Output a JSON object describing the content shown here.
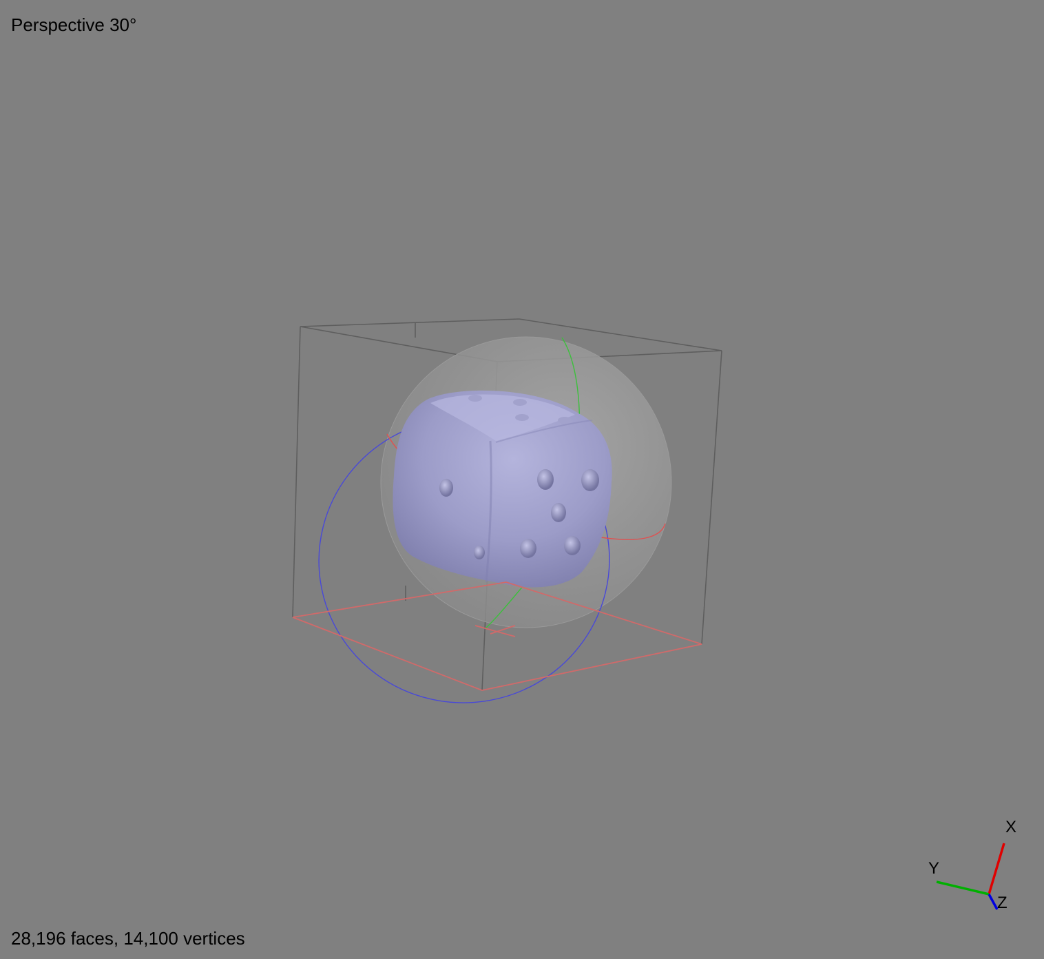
{
  "viewport": {
    "background": "#808080",
    "camera_mode": "Perspective 30°",
    "mesh_stats": "28,196 faces, 14,100 vertices"
  },
  "model": {
    "name": "die",
    "color": "#9c9cc8",
    "pips_visible_right_face": 5,
    "pips_visible_left_face": 2
  },
  "helpers": {
    "bounding_box_color": "#5a5a5a",
    "bounding_box_floor_color": "#d06a6a",
    "trackball_colors": {
      "x": "#ff4040",
      "y": "#30c030",
      "z": "#4040ff"
    }
  },
  "axis_gizmo": {
    "x_label": "X",
    "y_label": "Y",
    "z_label": "Z",
    "x_color": "#e00000",
    "y_color": "#00b000",
    "z_color": "#0000e0"
  }
}
